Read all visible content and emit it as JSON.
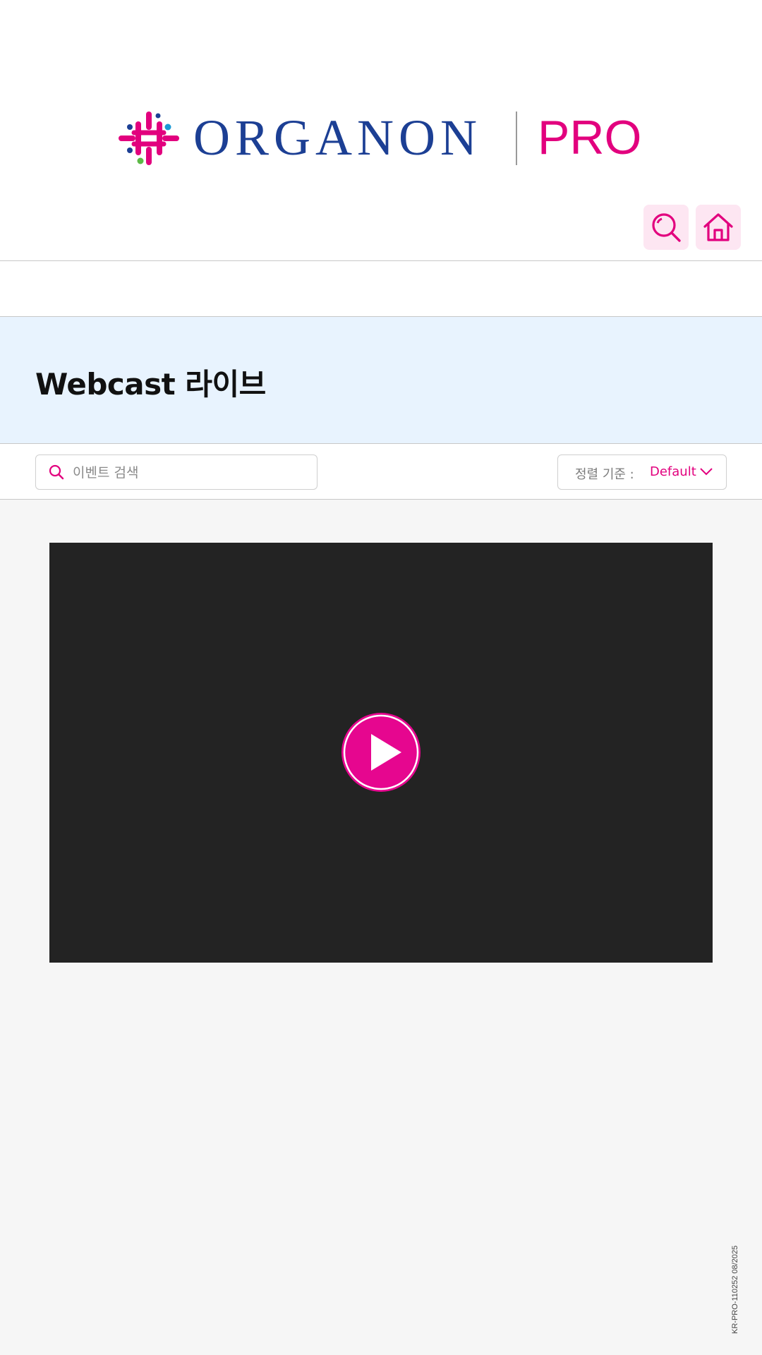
{
  "brand": {
    "name": "ORGANON",
    "suffix": "PRO",
    "primary_color": "#1c3f94",
    "accent_color": "#e2007e"
  },
  "header": {
    "search_icon": "search-icon",
    "home_icon": "home-icon"
  },
  "page": {
    "title": "Webcast 라이브"
  },
  "filters": {
    "search_placeholder": "이벤트 검색",
    "sort_label": "정렬 기준 :",
    "sort_value": "Default"
  },
  "video": {
    "play_icon": "play-icon"
  },
  "footer": {
    "doc_code": "KR-PRO-110252 08/2025"
  }
}
